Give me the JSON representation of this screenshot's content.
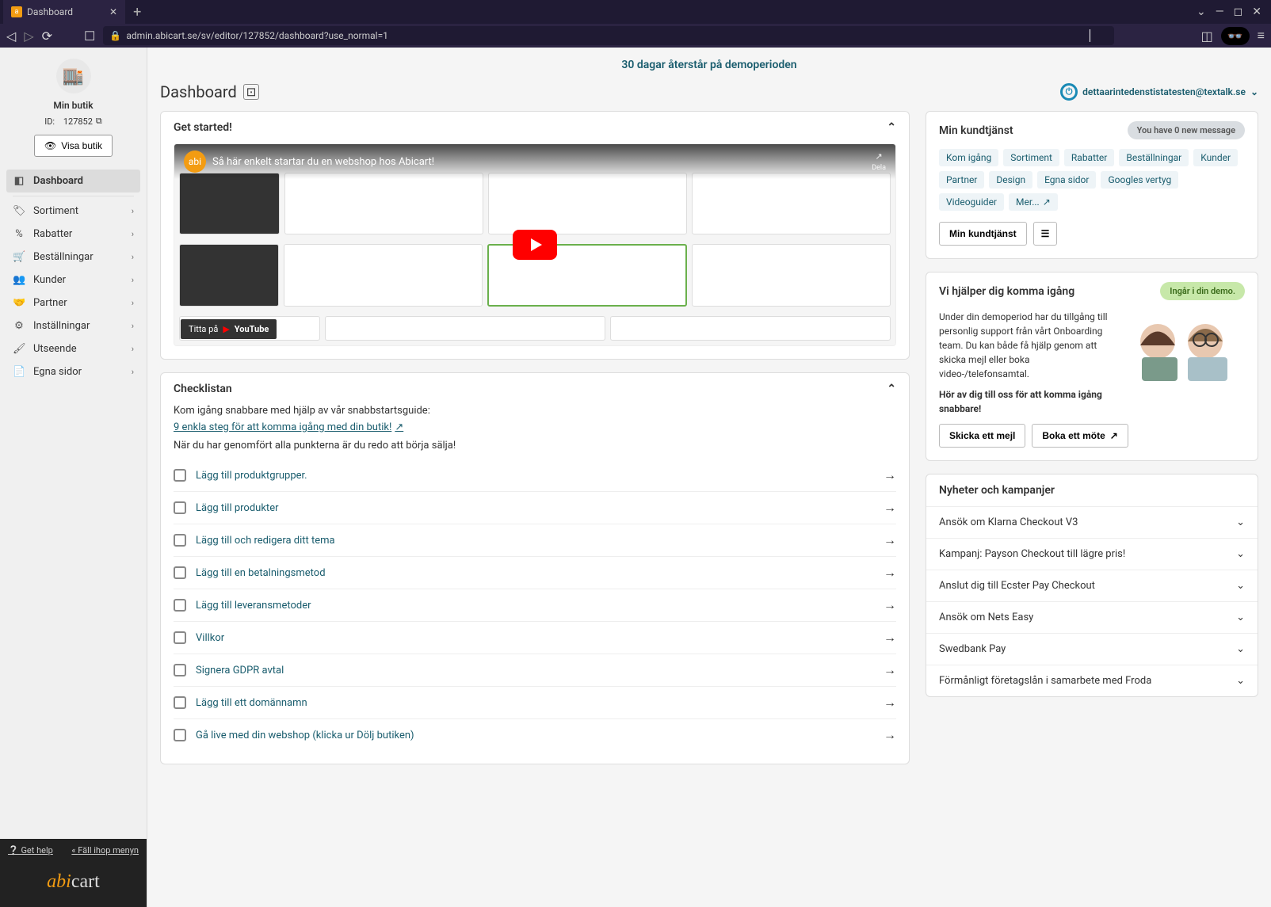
{
  "browser": {
    "tab_title": "Dashboard",
    "url": "admin.abicart.se/sv/editor/127852/dashboard?use_normal=1"
  },
  "trial_banner": "30 dagar återstår på demoperioden",
  "page_title": "Dashboard",
  "user_email": "dettaarintedenstistatesten@textalk.se",
  "sidebar": {
    "store_name": "Min butik",
    "id_label": "ID:",
    "id_value": "127852",
    "view_store_label": "Visa butik",
    "items": [
      {
        "label": "Dashboard",
        "icon": "◧",
        "active": true,
        "expandable": false
      },
      {
        "label": "Sortiment",
        "icon": "🏷",
        "expandable": true
      },
      {
        "label": "Rabatter",
        "icon": "%",
        "expandable": true
      },
      {
        "label": "Beställningar",
        "icon": "🛒",
        "expandable": true
      },
      {
        "label": "Kunder",
        "icon": "👥",
        "expandable": true
      },
      {
        "label": "Partner",
        "icon": "🤝",
        "expandable": true
      },
      {
        "label": "Inställningar",
        "icon": "⚙",
        "expandable": true
      },
      {
        "label": "Utseende",
        "icon": "🖌",
        "expandable": true
      },
      {
        "label": "Egna sidor",
        "icon": "📄",
        "expandable": true
      }
    ]
  },
  "footer": {
    "get_help": "Get help",
    "collapse_menu": "Fäll ihop menyn"
  },
  "video": {
    "title": "Så här enkelt startar du en webshop hos Abicart!",
    "watch_on": "Titta på",
    "youtube": "YouTube",
    "share": "Dela"
  },
  "getstarted": {
    "title": "Get started!"
  },
  "checklist": {
    "title": "Checklistan",
    "intro": "Kom igång snabbare med hjälp av vår snabbstartsguide:",
    "link": "9 enkla steg för att komma igång med din butik!",
    "note": "När du har genomfört alla punkterna är du redo att börja sälja!",
    "items": [
      "Lägg till produktgrupper.",
      "Lägg till produkter",
      "Lägg till och redigera ditt tema",
      "Lägg till en betalningsmetod",
      "Lägg till leveransmetoder",
      "Villkor",
      "Signera GDPR avtal",
      "Lägg till ett domännamn",
      "Gå live med din webshop (klicka ur Dölj butiken)"
    ]
  },
  "support": {
    "title": "Min kundtjänst",
    "badge": "You have 0 new message",
    "tags": [
      "Kom igång",
      "Sortiment",
      "Rabatter",
      "Beställningar",
      "Kunder",
      "Partner",
      "Design",
      "Egna sidor",
      "Googles vertyg",
      "Videoguider"
    ],
    "more": "Mer...",
    "btn": "Min kundtjänst"
  },
  "onboard": {
    "title": "Vi hjälper dig komma igång",
    "badge": "Ingår i din demo.",
    "text": "Under din demoperiod har du tillgång till personlig support från vårt Onboarding team. Du kan både få hjälp genom att skicka mejl eller boka video-/telefonsamtal.",
    "cta": "Hör av dig till oss för att komma igång snabbare!",
    "send_mail": "Skicka ett mejl",
    "book": "Boka ett möte"
  },
  "news": {
    "title": "Nyheter och kampanjer",
    "items": [
      "Ansök om Klarna Checkout V3",
      "Kampanj: Payson Checkout till lägre pris!",
      "Anslut dig till Ecster Pay Checkout",
      "Ansök om Nets Easy",
      "Swedbank Pay",
      "Förmånligt företagslån i samarbete med Froda"
    ]
  }
}
